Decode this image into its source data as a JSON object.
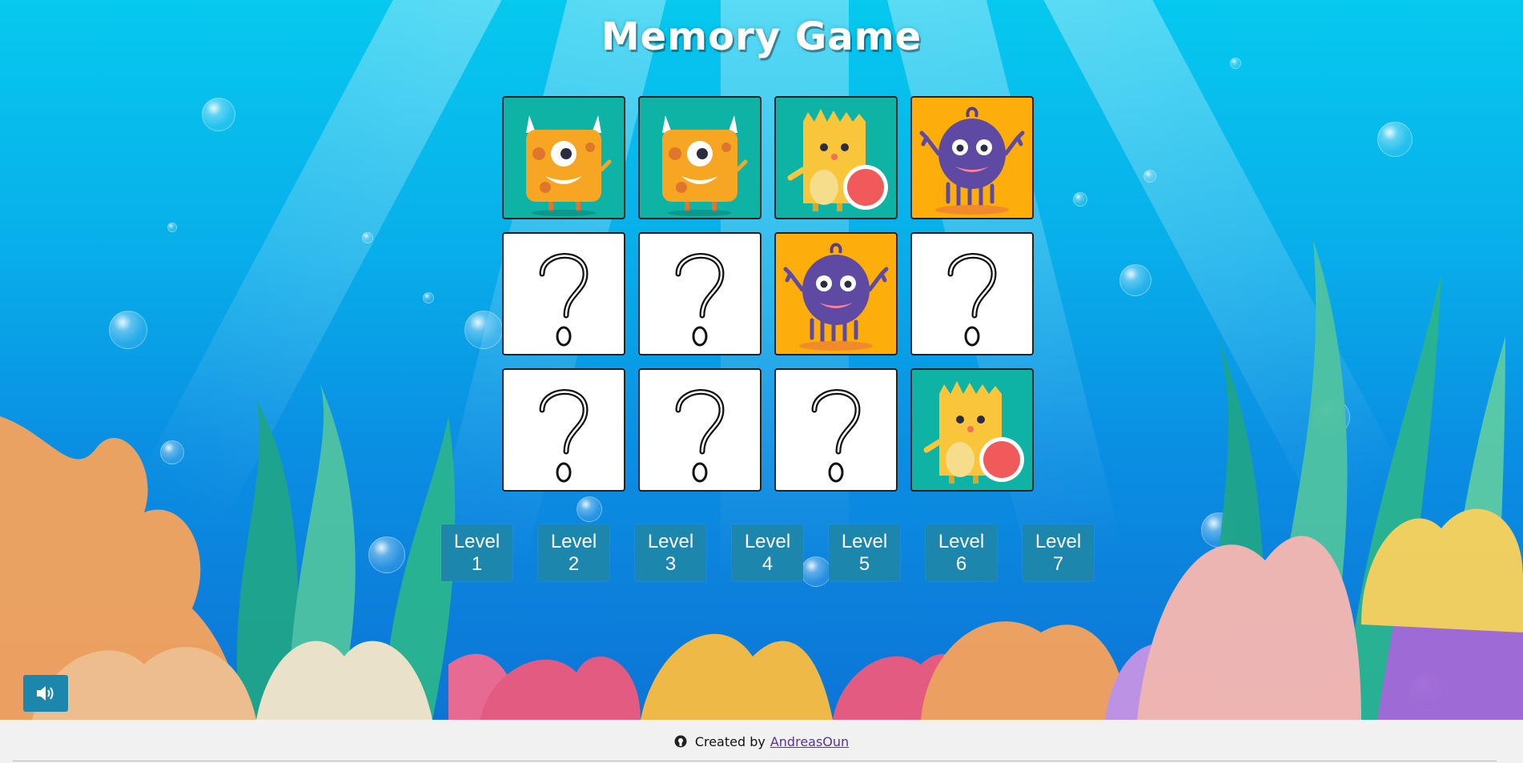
{
  "page": {
    "title": "Memory Game"
  },
  "board": {
    "cards": [
      {
        "state": "revealed",
        "face": "orange-horned-monster",
        "bg": "#0fb3a5"
      },
      {
        "state": "revealed",
        "face": "orange-horned-monster",
        "bg": "#0fb3a5"
      },
      {
        "state": "revealed",
        "face": "yellow-ball-monster",
        "bg": "#0fb3a5"
      },
      {
        "state": "revealed",
        "face": "purple-jelly-monster",
        "bg": "#fdae0b"
      },
      {
        "state": "hidden",
        "face": "question-mark"
      },
      {
        "state": "hidden",
        "face": "question-mark"
      },
      {
        "state": "revealed",
        "face": "purple-jelly-monster",
        "bg": "#fdae0b"
      },
      {
        "state": "hidden",
        "face": "question-mark"
      },
      {
        "state": "hidden",
        "face": "question-mark"
      },
      {
        "state": "hidden",
        "face": "question-mark"
      },
      {
        "state": "hidden",
        "face": "question-mark"
      },
      {
        "state": "revealed",
        "face": "yellow-ball-monster",
        "bg": "#0fb3a5"
      }
    ]
  },
  "levels": [
    {
      "word": "Level",
      "num": "1"
    },
    {
      "word": "Level",
      "num": "2"
    },
    {
      "word": "Level",
      "num": "3"
    },
    {
      "word": "Level",
      "num": "4"
    },
    {
      "word": "Level",
      "num": "5"
    },
    {
      "word": "Level",
      "num": "6"
    },
    {
      "word": "Level",
      "num": "7"
    }
  ],
  "sound": {
    "icon": "speaker-volume-icon"
  },
  "footer": {
    "icon": "github-icon",
    "created_by": "Created by",
    "author": "AndreasOun"
  },
  "colors": {
    "button": "#1d86ad",
    "teal_card": "#0fb3a5",
    "orange_card": "#fdae0b",
    "link": "#5a2fa0"
  }
}
